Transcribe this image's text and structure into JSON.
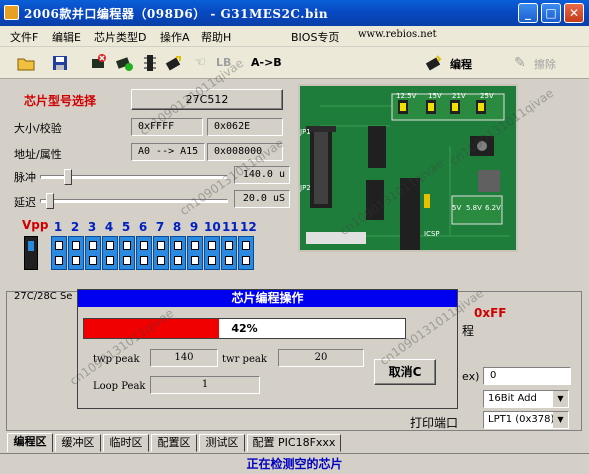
{
  "window": {
    "title": "2006款并口编程器（098D6） - G31MES2C.bin",
    "minimize": "_",
    "maximize": "□",
    "close": "✕"
  },
  "menu": [
    {
      "label": "文件F"
    },
    {
      "label": "编辑E"
    },
    {
      "label": "芯片类型D"
    },
    {
      "label": "操作A"
    },
    {
      "label": "帮助H"
    },
    {
      "label": "BIOS专页"
    },
    {
      "label": "www.rebios.net"
    }
  ],
  "toolbar": {
    "lb_label": "LB",
    "ab_label": "A->B",
    "program_label": "编程",
    "erase_label": "擦除"
  },
  "chip": {
    "select_label": "芯片型号选择",
    "model": "27C512",
    "size_label": "大小/校验",
    "size_value": "0xFFFF",
    "checksum_value": "0x062E",
    "addr_label": "地址/属性",
    "addr_range": "A0 --> A15",
    "addr_attr": "0x008000",
    "pulse_label": "脉冲",
    "pulse_value": "140.0 u",
    "delay_label": "延迟",
    "delay_value": "20.0 uS"
  },
  "dip": {
    "vpp_label": "Vpp",
    "pins": [
      "1",
      "2",
      "3",
      "4",
      "5",
      "6",
      "7",
      "8",
      "9",
      "10",
      "11",
      "12"
    ]
  },
  "board": {
    "voltages": [
      "12.5V",
      "15V",
      "21V",
      "25V"
    ],
    "voltages2": [
      "5V",
      "5.8V",
      "6.2V"
    ],
    "jp1": "JP1",
    "jp2": "JP2",
    "icsp": "ICSP"
  },
  "behind": {
    "group_label": "27C/28C Se",
    "hex_value": "0xFF",
    "sub_label": "程",
    "x_label": "ex)",
    "x_input": "0",
    "add_select": "16Bit Add",
    "print_label": "打印端口",
    "port_select": "LPT1 (0x378)"
  },
  "dialog": {
    "title": "芯片编程操作",
    "progress_text": "42%",
    "progress_fraction": 0.42,
    "twp_label": "twp peak",
    "twp_value": "140",
    "twr_label": "twr peak",
    "twr_value": "20",
    "loop_label": "Loop Peak",
    "loop_value": "1",
    "cancel_label": "取消C"
  },
  "tabs": [
    {
      "label": "编程区"
    },
    {
      "label": "缓冲区"
    },
    {
      "label": "临时区"
    },
    {
      "label": "配置区"
    },
    {
      "label": "测试区"
    },
    {
      "label": "配置 PIC18Fxxx"
    }
  ],
  "status": "正在检测空的芯片",
  "watermark": "cn1090131011qivae",
  "colors": {
    "accent": "#0000f0",
    "progress": "#f00000",
    "label_red": "#d00000",
    "board": "#1a7a3a"
  }
}
